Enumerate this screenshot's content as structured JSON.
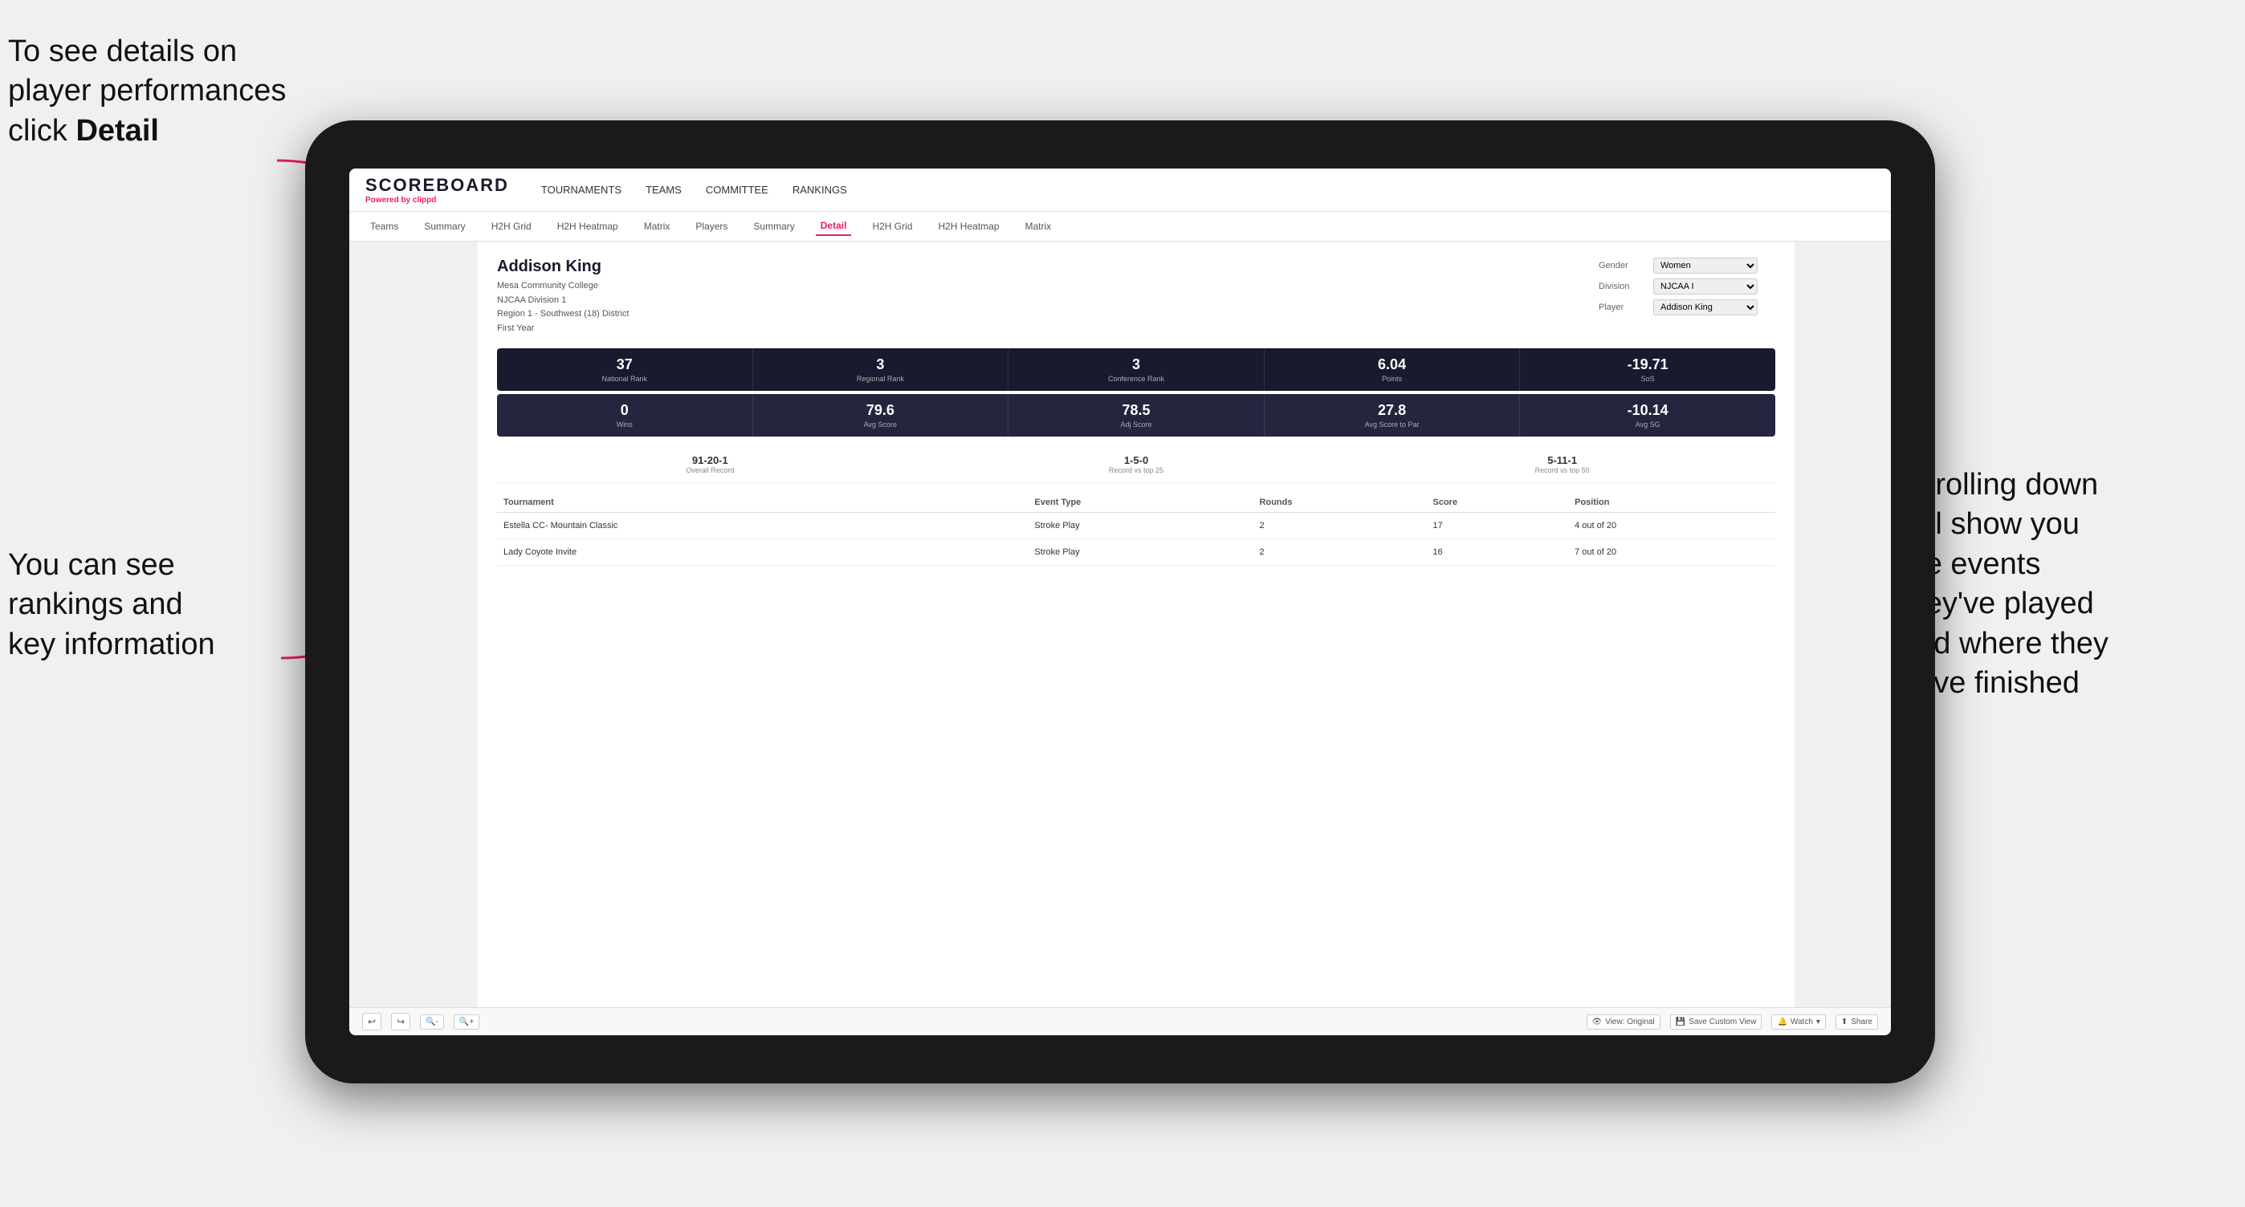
{
  "annotations": {
    "top_left": "To see details on player performances click ",
    "top_left_bold": "Detail",
    "bottom_left_line1": "You can see",
    "bottom_left_line2": "rankings and",
    "bottom_left_line3": "key information",
    "right_line1": "Scrolling down",
    "right_line2": "will show you",
    "right_line3": "the events",
    "right_line4": "they've played",
    "right_line5": "and where they",
    "right_line6": "have finished"
  },
  "header": {
    "logo": "SCOREBOARD",
    "powered_by": "Powered by ",
    "brand": "clippd",
    "nav": [
      "TOURNAMENTS",
      "TEAMS",
      "COMMITTEE",
      "RANKINGS"
    ]
  },
  "sub_nav": {
    "items": [
      "Teams",
      "Summary",
      "H2H Grid",
      "H2H Heatmap",
      "Matrix",
      "Players",
      "Summary",
      "Detail",
      "H2H Grid",
      "H2H Heatmap",
      "Matrix"
    ],
    "active": "Detail"
  },
  "player": {
    "name": "Addison King",
    "school": "Mesa Community College",
    "division": "NJCAA Division 1",
    "region": "Region 1 - Southwest (18) District",
    "year": "First Year",
    "gender_label": "Gender",
    "gender_value": "Women",
    "division_label": "Division",
    "division_value": "NJCAA I",
    "player_label": "Player",
    "player_value": "Addison King"
  },
  "stats_row1": [
    {
      "value": "37",
      "label": "National Rank"
    },
    {
      "value": "3",
      "label": "Regional Rank"
    },
    {
      "value": "3",
      "label": "Conference Rank"
    },
    {
      "value": "6.04",
      "label": "Points"
    },
    {
      "value": "-19.71",
      "label": "SoS"
    }
  ],
  "stats_row2": [
    {
      "value": "0",
      "label": "Wins"
    },
    {
      "value": "79.6",
      "label": "Avg Score"
    },
    {
      "value": "78.5",
      "label": "Adj Score"
    },
    {
      "value": "27.8",
      "label": "Avg Score to Par"
    },
    {
      "value": "-10.14",
      "label": "Avg SG"
    }
  ],
  "records": [
    {
      "value": "91-20-1",
      "label": "Overall Record"
    },
    {
      "value": "1-5-0",
      "label": "Record vs top 25"
    },
    {
      "value": "5-11-1",
      "label": "Record vs top 50"
    }
  ],
  "table": {
    "headers": [
      "Tournament",
      "",
      "Event Type",
      "Rounds",
      "Score",
      "Position"
    ],
    "rows": [
      {
        "tournament": "Estella CC- Mountain Classic",
        "event_type": "Stroke Play",
        "rounds": "2",
        "score": "17",
        "position": "4 out of 20"
      },
      {
        "tournament": "Lady Coyote Invite",
        "event_type": "Stroke Play",
        "rounds": "2",
        "score": "16",
        "position": "7 out of 20"
      }
    ]
  },
  "toolbar": {
    "undo": "↩",
    "redo": "↪",
    "view_original": "View: Original",
    "save_custom": "Save Custom View",
    "watch": "Watch",
    "share": "Share"
  }
}
